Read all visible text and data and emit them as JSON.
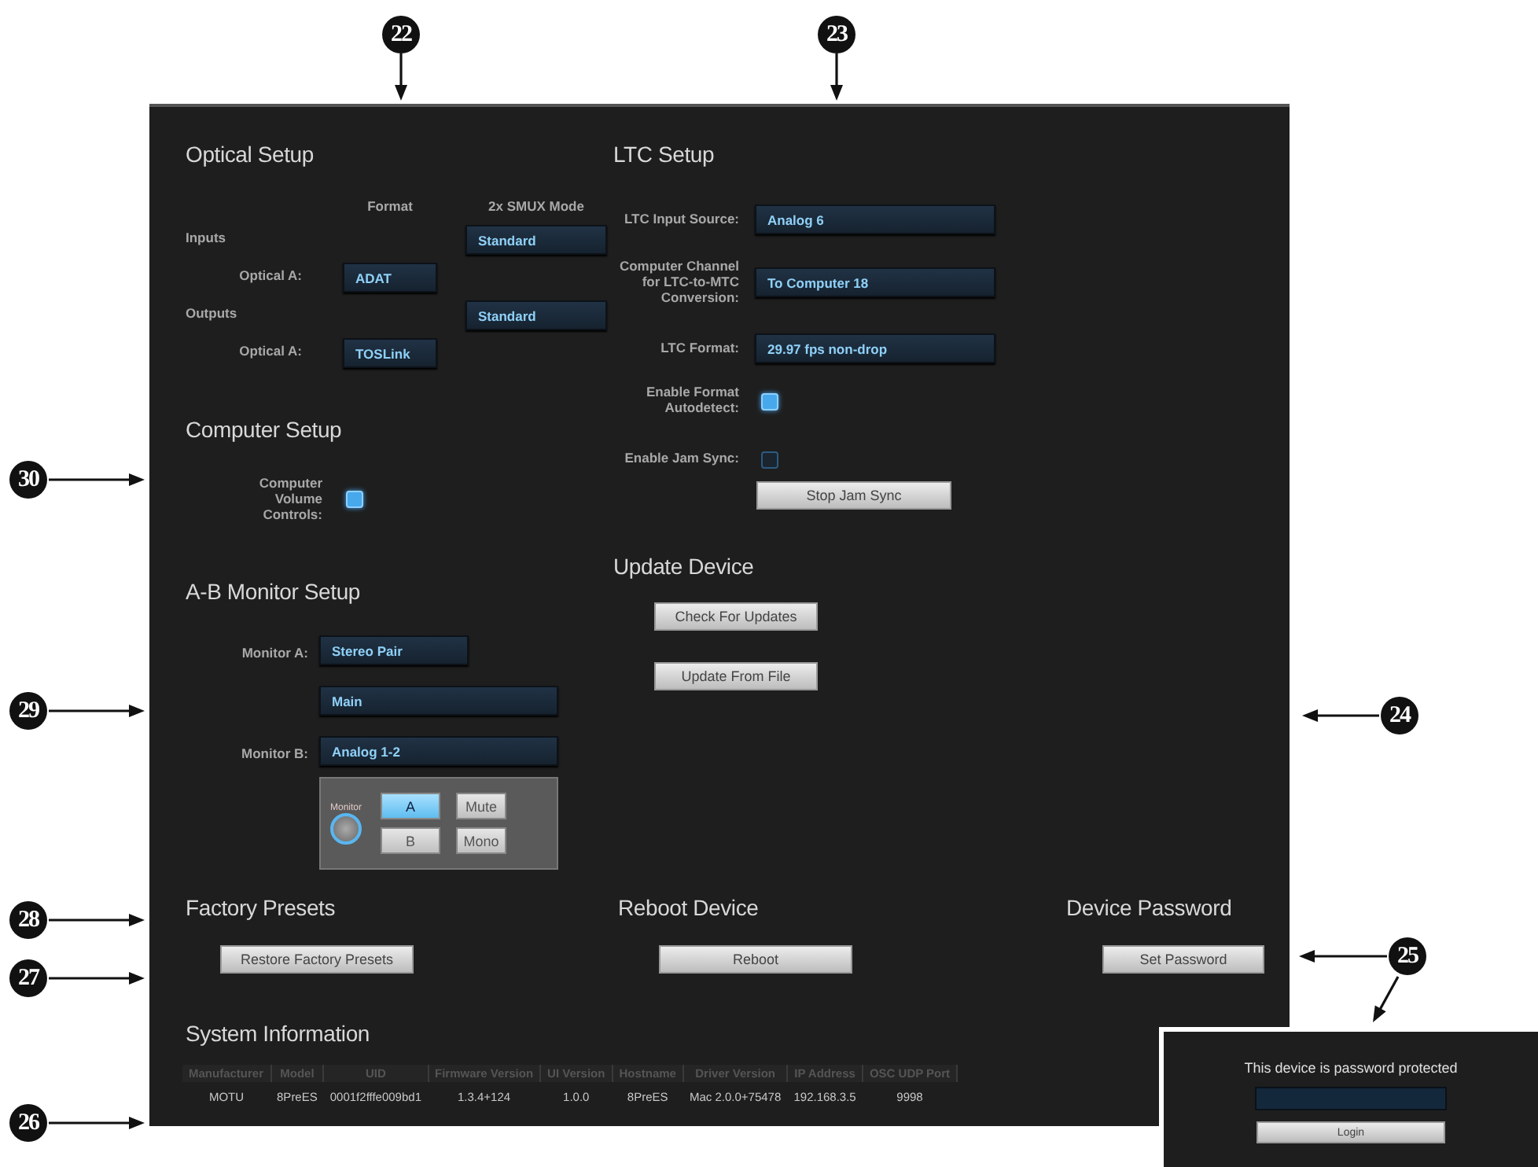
{
  "callouts": [
    {
      "number": "22"
    },
    {
      "number": "23"
    },
    {
      "number": "30"
    },
    {
      "number": "29"
    },
    {
      "number": "24"
    },
    {
      "number": "28"
    },
    {
      "number": "25"
    },
    {
      "number": "27"
    },
    {
      "number": "26"
    }
  ],
  "optical_setup": {
    "title": "Optical Setup",
    "columns": [
      "Format",
      "2x SMUX Mode"
    ],
    "rows": [
      {
        "kind": "group",
        "label": "Inputs",
        "value": "Standard"
      },
      {
        "kind": "port",
        "label": "Optical A:",
        "value": "ADAT"
      },
      {
        "kind": "group",
        "label": "Outputs",
        "value": "Standard"
      },
      {
        "kind": "port",
        "label": "Optical A:",
        "value": "TOSLink"
      }
    ]
  },
  "computer_setup": {
    "title": "Computer Setup",
    "label": "Computer Volume Controls:",
    "checked": true
  },
  "ab_monitor_setup": {
    "title": "A-B Monitor Setup",
    "rows": [
      {
        "label": "Monitor A:",
        "value": "Stereo Pair"
      },
      {
        "label": "",
        "value": "Main"
      },
      {
        "label": "Monitor B:",
        "value": "Analog 1-2"
      }
    ],
    "monitor_panel": {
      "knob_label": "Monitor",
      "buttons": [
        {
          "label": "A",
          "selected": true
        },
        {
          "label": "Mute",
          "selected": false
        },
        {
          "label": "B",
          "selected": false
        },
        {
          "label": "Mono",
          "selected": false
        }
      ]
    }
  },
  "ltc_setup": {
    "title": "LTC Setup",
    "rows": [
      {
        "kind": "dropdown",
        "label": "LTC Input Source:",
        "value": "Analog 6"
      },
      {
        "kind": "dropdown",
        "label": "Computer Channel for LTC-to-MTC Conversion:",
        "value": "To Computer 18"
      },
      {
        "kind": "dropdown",
        "label": "LTC Format:",
        "value": "29.97 fps non-drop"
      },
      {
        "kind": "checkbox",
        "label": "Enable Format Autodetect:",
        "checked": true
      },
      {
        "kind": "checkbox",
        "label": "Enable Jam Sync:",
        "checked": false
      }
    ],
    "button": "Stop Jam Sync"
  },
  "update_device": {
    "title": "Update Device",
    "buttons": [
      "Check For Updates",
      "Update From File"
    ]
  },
  "factory_presets": {
    "title": "Factory Presets",
    "button": "Restore Factory Presets"
  },
  "reboot_device": {
    "title": "Reboot Device",
    "button": "Reboot"
  },
  "device_password": {
    "title": "Device Password",
    "button": "Set Password"
  },
  "system_information": {
    "title": "System Information",
    "columns": [
      "Manufacturer",
      "Model",
      "UID",
      "Firmware Version",
      "UI Version",
      "Hostname",
      "Driver Version",
      "IP Address",
      "OSC UDP Port"
    ],
    "row": [
      "MOTU",
      "8PreES",
      "0001f2fffe009bd1",
      "1.3.4+124",
      "1.0.0",
      "8PreES",
      "Mac 2.0.0+75478",
      "192.168.3.5",
      "9998"
    ]
  },
  "login_panel": {
    "message": "This device is password protected",
    "button": "Login"
  }
}
